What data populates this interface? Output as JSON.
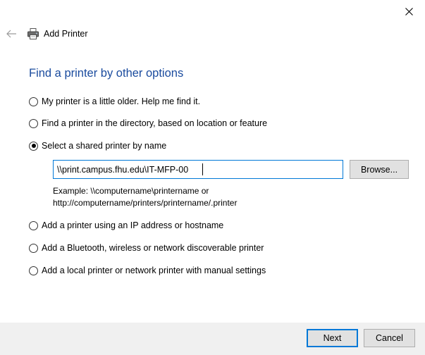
{
  "window": {
    "title": "Add Printer",
    "close_icon": "close-icon",
    "back_icon": "back-arrow-icon",
    "app_icon": "printer-icon"
  },
  "heading": "Find a printer by other options",
  "options": [
    {
      "label": "My printer is a little older. Help me find it.",
      "checked": false
    },
    {
      "label": "Find a printer in the directory, based on location or feature",
      "checked": false
    },
    {
      "label": "Select a shared printer by name",
      "checked": true
    },
    {
      "label": "Add a printer using an IP address or hostname",
      "checked": false
    },
    {
      "label": "Add a Bluetooth, wireless or network discoverable printer",
      "checked": false
    },
    {
      "label": "Add a local printer or network printer with manual settings",
      "checked": false
    }
  ],
  "shared_printer": {
    "value": "\\\\print.campus.fhu.edu\\IT-MFP-00",
    "browse_label": "Browse...",
    "example_line1": "Example: \\\\computername\\printername or",
    "example_line2": "http://computername/printers/printername/.printer"
  },
  "footer": {
    "next_label": "Next",
    "cancel_label": "Cancel"
  },
  "colors": {
    "heading": "#1a4b9e",
    "focus_border": "#0078d7",
    "button_bg": "#e1e1e1",
    "footer_bg": "#f0f0f0"
  }
}
